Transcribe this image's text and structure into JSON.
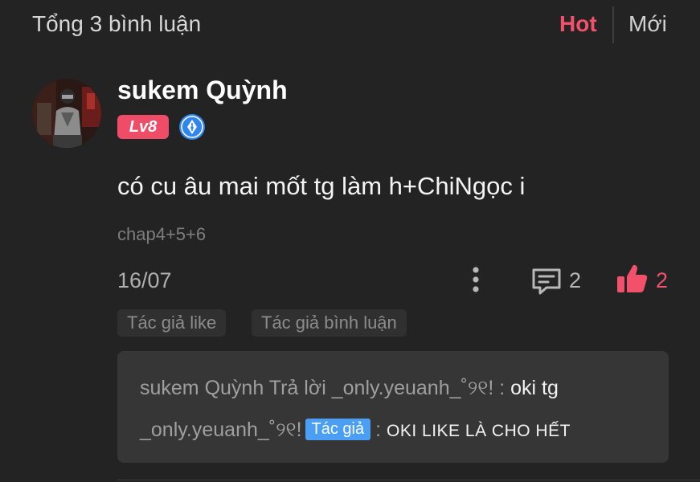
{
  "header": {
    "total_label": "Tổng 3 bình luận",
    "sort_hot": "Hot",
    "sort_new": "Mới"
  },
  "comment": {
    "username": "sukem Quỳnh",
    "level": "Lv8",
    "text": "có cu âu mai mốt tg làm h+ChiNgọc i",
    "chapter": "chap4+5+6",
    "date": "16/07",
    "reply_count": "2",
    "like_count": "2",
    "chips": [
      "Tác giả like",
      "Tác giả bình luận"
    ]
  },
  "replies": {
    "first": {
      "author": "sukem Quỳnh",
      "reply_word": "Trả lời",
      "target": "_only.yeuanh_˚୨୧!",
      "separator": ":",
      "content": "oki tg"
    },
    "second": {
      "author": "_only.yeuanh_˚୨୧!",
      "badge": "Tác giả",
      "separator": ":",
      "content": "OKI LIKE LÀ CHO HẾT"
    }
  },
  "colors": {
    "background": "#232323",
    "accent": "#f2516b",
    "badge_blue": "#4a9ff5"
  },
  "icons": {
    "more": "more-vertical-icon",
    "reply": "comment-icon",
    "like": "thumbs-up-icon",
    "author_badge": "pen-nib-badge-icon"
  }
}
